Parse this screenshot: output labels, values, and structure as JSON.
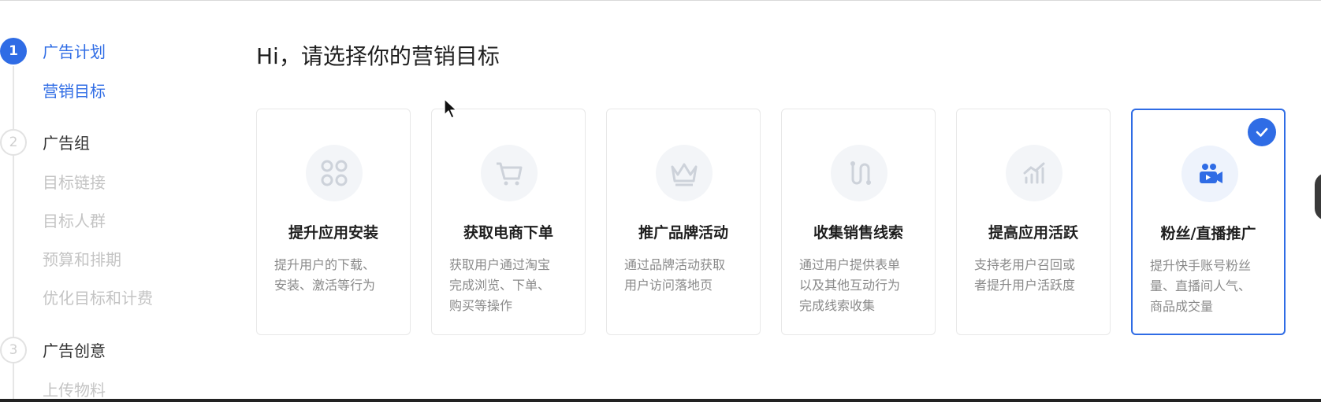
{
  "steps": [
    {
      "number": "1",
      "title": "广告计划",
      "state": "active",
      "subs": [
        "营销目标"
      ]
    },
    {
      "number": "2",
      "title": "广告组",
      "state": "inactive",
      "subs": [
        "目标链接",
        "目标人群",
        "预算和排期",
        "优化目标和计费"
      ]
    },
    {
      "number": "3",
      "title": "广告创意",
      "state": "inactive",
      "subs": [
        "上传物料"
      ]
    }
  ],
  "main": {
    "title": "Hi，请选择你的营销目标",
    "cards": [
      {
        "title": "提升应用安装",
        "desc": [
          "提升用户的下载、",
          "安装、激活等行为"
        ],
        "icon": "app-grid-icon",
        "selected": false
      },
      {
        "title": "获取电商下单",
        "desc": [
          "获取用户通过淘宝",
          "完成浏览、下单、",
          "购买等操作"
        ],
        "icon": "shopping-cart-icon",
        "selected": false
      },
      {
        "title": "推广品牌活动",
        "desc": [
          "通过品牌活动获取",
          "用户访问落地页"
        ],
        "icon": "crown-icon",
        "selected": false
      },
      {
        "title": "收集销售线索",
        "desc": [
          "通过用户提供表单",
          "以及其他互动行为",
          "完成线索收集"
        ],
        "icon": "lead-path-icon",
        "selected": false
      },
      {
        "title": "提高应用活跃",
        "desc": [
          "支持老用户召回或",
          "者提升用户活跃度"
        ],
        "icon": "growth-chart-icon",
        "selected": false
      },
      {
        "title": "粉丝/直播推广",
        "desc": [
          "提升快手账号粉丝",
          "量、直播间人气、",
          "商品成交量"
        ],
        "icon": "live-camera-icon",
        "selected": true
      }
    ]
  },
  "colors": {
    "accent": "#2f6ce5",
    "muted": "#c4c4c4",
    "desc": "#8a8a8a"
  }
}
